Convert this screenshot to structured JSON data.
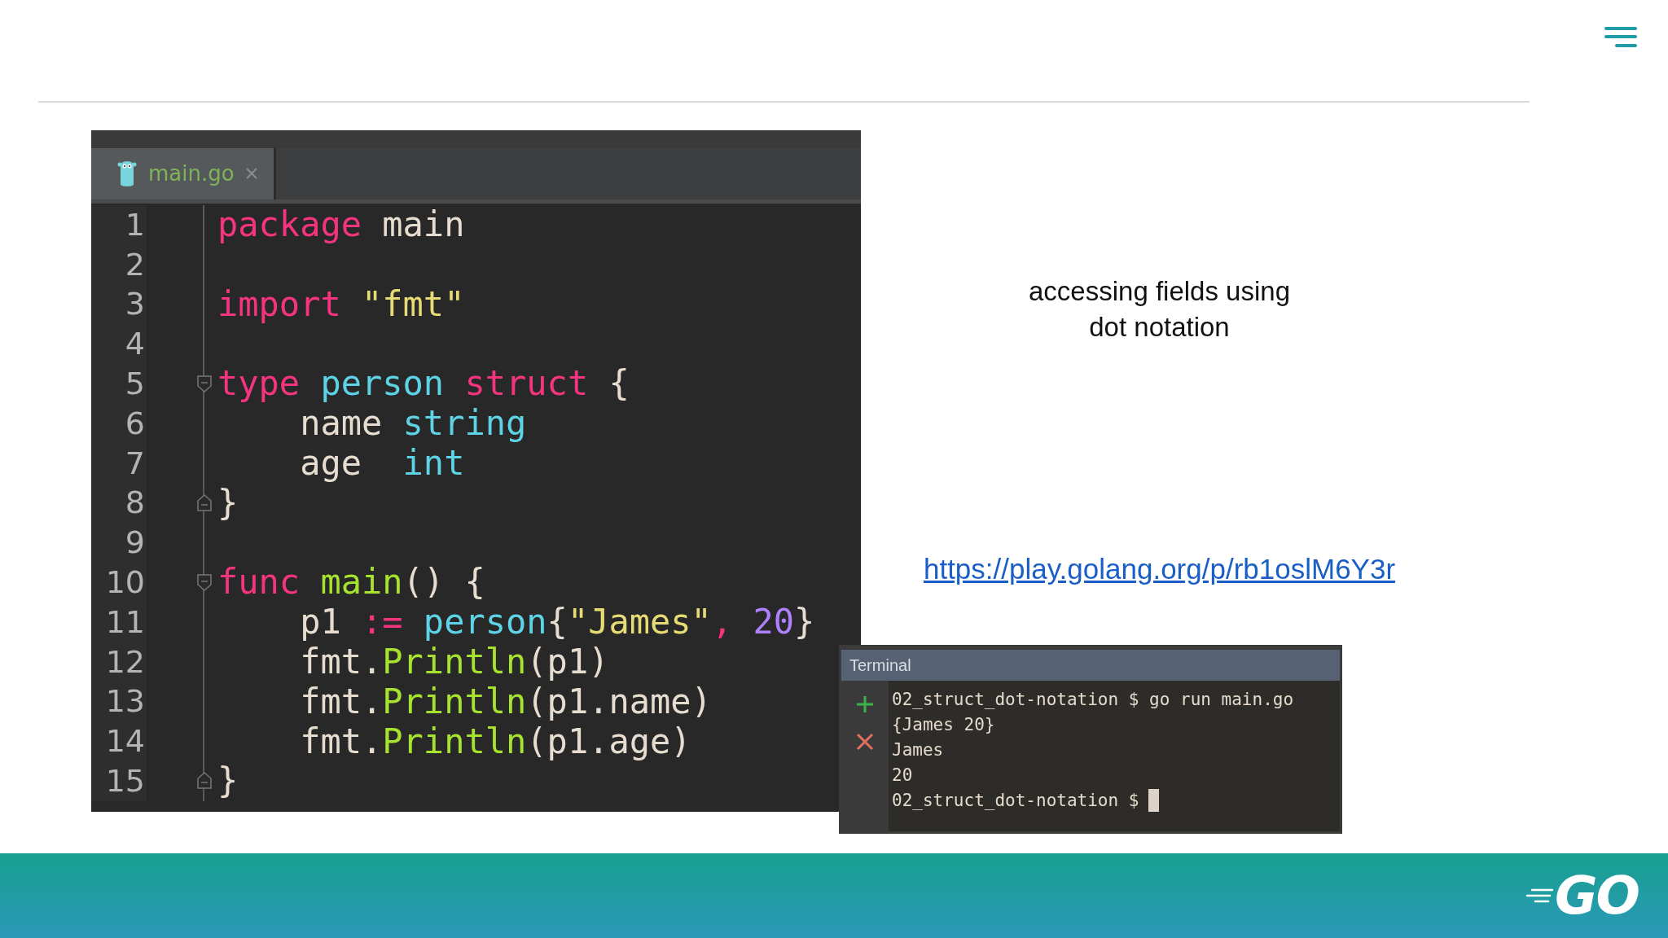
{
  "editor": {
    "tabs": [
      {
        "label": "main.go",
        "selected": true
      }
    ],
    "lines": [
      {
        "number": "1",
        "kind": "plain",
        "tokens": [
          {
            "kind": "keyword",
            "text": "package"
          },
          {
            "kind": "plain",
            "text": " main"
          }
        ]
      },
      {
        "number": "2",
        "kind": "plain"
      },
      {
        "number": "3",
        "kind": "plain",
        "tokens": [
          {
            "kind": "keyword",
            "text": "import"
          },
          {
            "kind": "string",
            "text": " \"fmt\""
          }
        ]
      },
      {
        "number": "4",
        "kind": "plain"
      },
      {
        "number": "5",
        "kind": "start",
        "tokens": [
          {
            "kind": "keyword",
            "text": "type"
          },
          {
            "kind": "type",
            "text": " person"
          },
          {
            "kind": "keyword",
            "text": " struct"
          },
          {
            "kind": "plain",
            "text": " {"
          }
        ]
      },
      {
        "number": "6",
        "kind": "plain",
        "tokens": [
          {
            "kind": "plain",
            "text": "    name"
          },
          {
            "kind": "type",
            "text": " string"
          }
        ]
      },
      {
        "number": "7",
        "kind": "plain",
        "tokens": [
          {
            "kind": "plain",
            "text": "    age"
          },
          {
            "kind": "type",
            "text": "  int"
          }
        ]
      },
      {
        "number": "8",
        "kind": "end",
        "tokens": [
          {
            "kind": "plain",
            "text": "}"
          }
        ]
      },
      {
        "number": "9",
        "kind": "plain"
      },
      {
        "number": "10",
        "kind": "start",
        "tokens": [
          {
            "kind": "keyword",
            "text": "func"
          },
          {
            "kind": "function",
            "text": " main"
          },
          {
            "kind": "plain",
            "text": "() {"
          }
        ]
      },
      {
        "number": "11",
        "kind": "plain",
        "tokens": [
          {
            "kind": "plain",
            "text": "    p1"
          },
          {
            "kind": "keyword",
            "text": " :="
          },
          {
            "kind": "type",
            "text": " person"
          },
          {
            "kind": "plain",
            "text": "{"
          },
          {
            "kind": "string",
            "text": "\"James\""
          },
          {
            "kind": "keyword",
            "text": ","
          },
          {
            "kind": "number",
            "text": " 20"
          },
          {
            "kind": "plain",
            "text": "}"
          }
        ]
      },
      {
        "number": "12",
        "kind": "plain",
        "tokens": [
          {
            "kind": "plain",
            "text": "    fmt."
          },
          {
            "kind": "function",
            "text": "Println"
          },
          {
            "kind": "plain",
            "text": "(p1)"
          }
        ]
      },
      {
        "number": "13",
        "kind": "plain",
        "tokens": [
          {
            "kind": "plain",
            "text": "    fmt."
          },
          {
            "kind": "function",
            "text": "Println"
          },
          {
            "kind": "plain",
            "text": "(p1.name)"
          }
        ]
      },
      {
        "number": "14",
        "kind": "plain",
        "tokens": [
          {
            "kind": "plain",
            "text": "    fmt."
          },
          {
            "kind": "function",
            "text": "Println"
          },
          {
            "kind": "plain",
            "text": "(p1.age)"
          }
        ]
      },
      {
        "number": "15",
        "kind": "end",
        "tokens": [
          {
            "kind": "plain",
            "text": "}"
          }
        ]
      }
    ]
  },
  "caption": "accessing fields using dot notation",
  "link": "https://play.golang.org/p/rb1oslM6Y3r",
  "terminal": {
    "title": "Terminal",
    "cursor": true,
    "lines": [
      "02_struct_dot-notation $ go run main.go",
      "{James 20}",
      "James",
      "20",
      "02_struct_dot-notation $"
    ]
  },
  "footer": {
    "logo": "GO"
  }
}
